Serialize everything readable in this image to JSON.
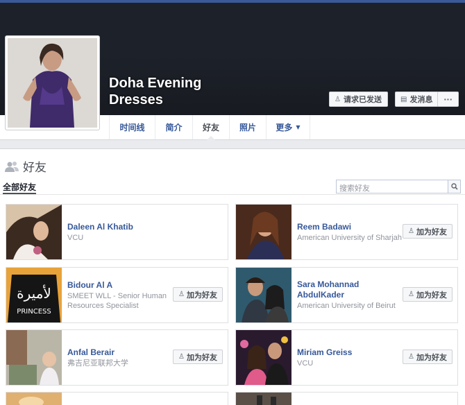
{
  "page": {
    "name_line1": "Doha Evening",
    "name_line2": "Dresses"
  },
  "actions": {
    "request_sent": "请求已发送",
    "message": "发消息",
    "more": "···"
  },
  "tabs": [
    {
      "label": "时间线"
    },
    {
      "label": "简介"
    },
    {
      "label": "好友"
    },
    {
      "label": "照片"
    },
    {
      "label": "更多"
    }
  ],
  "friends": {
    "title": "好友",
    "filter_all": "全部好友",
    "search_placeholder": "搜索好友",
    "add_label": "加为好友",
    "items": [
      {
        "name": "Daleen Al Khatib",
        "sub1": "VCU",
        "sub2": ""
      },
      {
        "name": "Reem Badawi",
        "sub1": "American University of Sharjah",
        "sub2": ""
      },
      {
        "name": "Bidour Al A",
        "sub1": "SMEET WLL - Senior Human",
        "sub2": "Resources Specialist"
      },
      {
        "name": "Sara Mohannad",
        "name2": "AbdulKader",
        "sub1": "American University of Beirut",
        "sub2": ""
      },
      {
        "name": "Anfal Berair",
        "sub1": "弗吉尼亚联邦大学",
        "sub2": ""
      },
      {
        "name": "Miriam Greiss",
        "sub1": "VCU",
        "sub2": ""
      }
    ]
  },
  "colors": {
    "link": "#365899",
    "cover": "#1d2129",
    "accent": "#3b5998"
  }
}
